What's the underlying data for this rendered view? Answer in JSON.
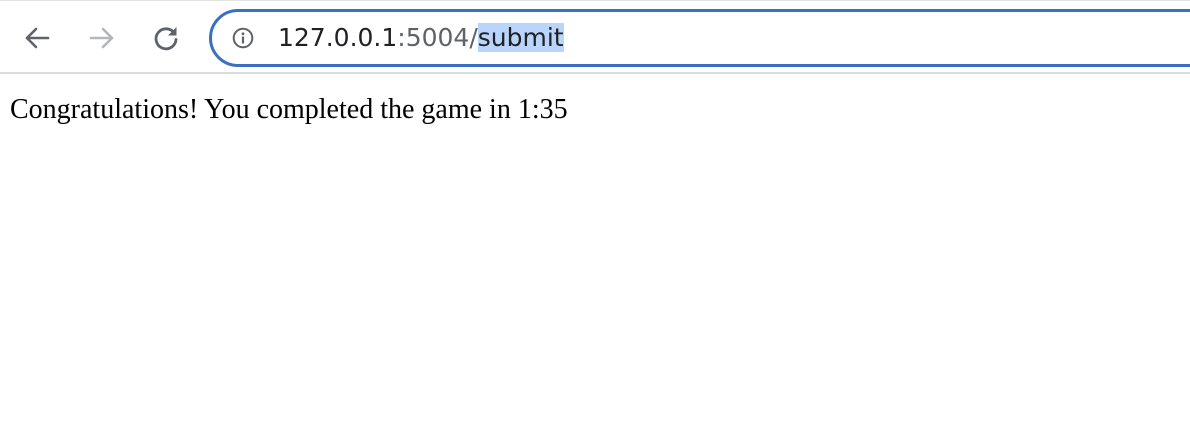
{
  "browser": {
    "toolbar": {
      "back_icon": "arrow-left-icon",
      "forward_icon": "arrow-right-icon",
      "reload_icon": "reload-icon"
    },
    "omnibox": {
      "info_icon": "info-icon",
      "url_host": "127.0.0.1",
      "url_port": ":5004/",
      "url_path": "submit",
      "border_color": "#3a6fc3",
      "selection_color": "#b9d5fb"
    }
  },
  "page": {
    "message": "Congratulations! You completed the game in 1:35"
  }
}
